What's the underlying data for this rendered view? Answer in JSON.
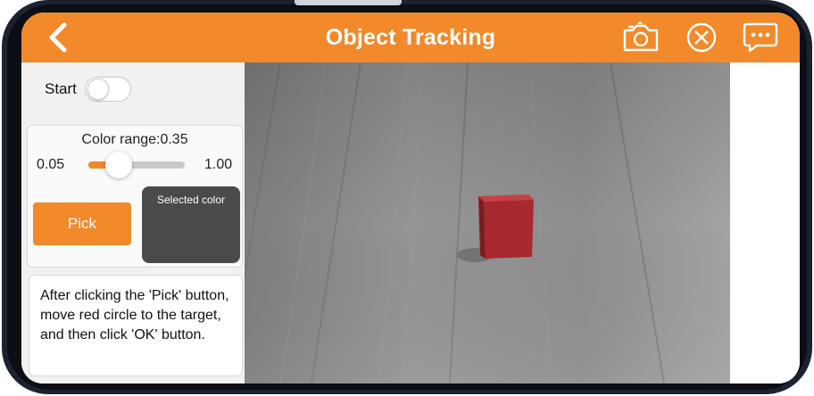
{
  "header": {
    "title": "Object Tracking",
    "back_icon": "chevron-left-icon",
    "icons": [
      "camera-icon",
      "close-circle-icon",
      "chat-icon"
    ]
  },
  "controls": {
    "start_label": "Start",
    "start_on": false,
    "color_range_label": "Color range:0.35",
    "range_min": "0.05",
    "range_max": "1.00",
    "range_value": 0.35,
    "pick_label": "Pick",
    "selected_color_label": "Selected color",
    "selected_color": "#4a4a4a"
  },
  "hint": {
    "text": "After clicking the 'Pick' button, move red circle to the target, and then click 'OK' button."
  },
  "colors": {
    "accent": "#f2892a",
    "panel_bg": "#f1f1f1",
    "cube": "#a82a2e"
  }
}
